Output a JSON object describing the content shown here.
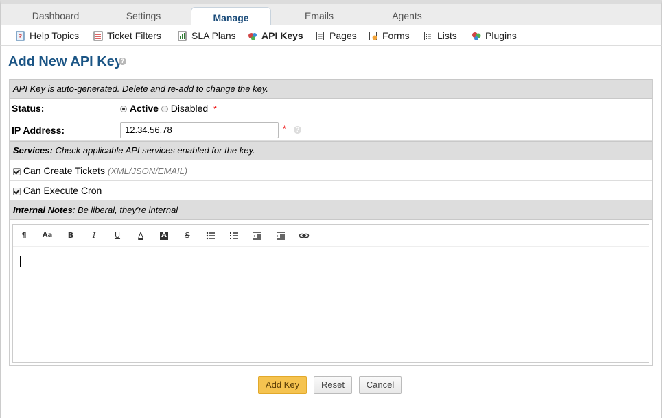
{
  "tabs": [
    {
      "label": "Dashboard"
    },
    {
      "label": "Settings"
    },
    {
      "label": "Manage"
    },
    {
      "label": "Emails"
    },
    {
      "label": "Agents"
    }
  ],
  "subnav": [
    {
      "label": "Help Topics",
      "icon": "help-topics-icon"
    },
    {
      "label": "Ticket Filters",
      "icon": "filter-icon"
    },
    {
      "label": "SLA Plans",
      "icon": "sla-icon"
    },
    {
      "label": "API Keys",
      "icon": "api-key-icon"
    },
    {
      "label": "Pages",
      "icon": "page-icon"
    },
    {
      "label": "Forms",
      "icon": "form-icon"
    },
    {
      "label": "Lists",
      "icon": "list-icon"
    },
    {
      "label": "Plugins",
      "icon": "plugin-icon"
    }
  ],
  "page": {
    "title": "Add New API Key"
  },
  "form": {
    "intro": "API Key is auto-generated. Delete and re-add to change the key.",
    "status_label": "Status:",
    "status_active": "Active",
    "status_disabled": "Disabled",
    "required_mark": "*",
    "ip_label": "IP Address:",
    "ip_value": "12.34.56.78",
    "services_label": "Services:",
    "services_desc": " Check applicable API services enabled for the key.",
    "can_create_label": "Can Create Tickets",
    "can_create_note": "(XML/JSON/EMAIL)",
    "can_cron_label": "Can Execute Cron",
    "notes_label": "Internal Notes",
    "notes_desc": ": Be liberal, they're internal"
  },
  "toolbar": {
    "paragraph": "¶",
    "size": "Aa",
    "bold": "B",
    "italic": "I",
    "underline": "U",
    "font_color": "A",
    "bg_color": "A",
    "strike": "S"
  },
  "buttons": {
    "add": "Add Key",
    "reset": "Reset",
    "cancel": "Cancel"
  },
  "colors": {
    "accent": "#1b5585",
    "primary_button": "#f5c350",
    "header_bg": "#dddddd"
  }
}
